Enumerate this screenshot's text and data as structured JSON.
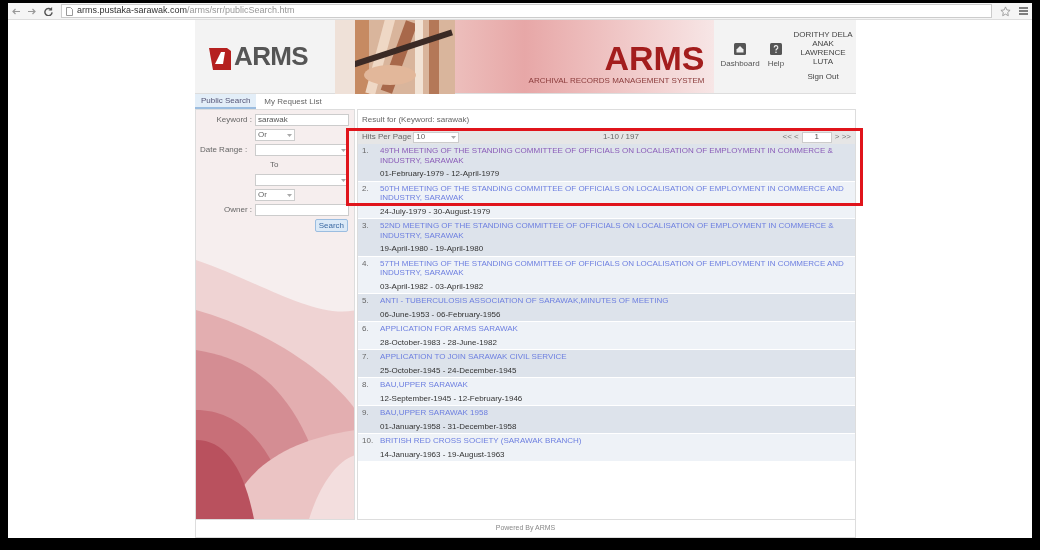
{
  "browser": {
    "url": "**arms.pustaka-sarawak.com**/arms/srr/publicSearch.htm"
  },
  "header": {
    "logo": "ARMS",
    "title": "ARMS",
    "subtitle": "ARCHIVAL RECORDS MANAGEMENT SYSTEM",
    "nav": [
      {
        "kind": "home",
        "label": "Dashboard"
      },
      {
        "kind": "help",
        "label": "Help"
      }
    ],
    "user": "DORITHY DELA ANAK LAWRENCE LUTA",
    "sign_out": "Sign Out"
  },
  "tabs": [
    {
      "label": "Public Search",
      "selected": true
    },
    {
      "label": "My Request List",
      "selected": false
    }
  ],
  "search": {
    "keyword_label": "Keyword :",
    "keyword": "sarawak",
    "operator_1": "Or",
    "date_label": "Date Range :",
    "to_label": "To",
    "operator_2": "Or",
    "owner_label": "Owner :",
    "button": "Search"
  },
  "results": {
    "heading": "Result for (Keyword: sarawak)",
    "hits_label": "Hits Per Page",
    "hits": "10",
    "range": "1-10 / 197",
    "first": "<< <",
    "page": "1",
    "next": "> >>",
    "rows": [
      {
        "number": "1.",
        "title": "49TH MEETING OF THE STANDING COMMITTEE OF OFFICIALS ON LOCALISATION OF EMPLOYMENT IN COMMERCE & INDUSTRY, SARAWAK",
        "dates": "01-February-1979 - 12-April-1979",
        "visited": true
      },
      {
        "number": "2.",
        "title": "50TH MEETING OF THE STANDING COMMITTEE OF OFFICIALS ON LOCALISATION OF EMPLOYMENT IN COMMERCE AND INDUSTRY, SARAWAK",
        "dates": "24-July-1979 - 30-August-1979",
        "visited": false
      },
      {
        "number": "3.",
        "title": "52ND MEETING OF THE STANDING COMMITTEE OF OFFICIALS ON LOCALISATION OF EMPLOYMENT IN COMMERCE & INDUSTRY, SARAWAK",
        "dates": "19-April-1980 - 19-April-1980",
        "visited": false
      },
      {
        "number": "4.",
        "title": "57TH MEETING OF THE STANDING COMMITTEE OF OFFICIALS ON LOCALISATION OF EMPLOYMENT IN COMMERCE AND INDUSTRY, SARAWAK",
        "dates": "03-April-1982 - 03-April-1982",
        "visited": false
      },
      {
        "number": "5.",
        "title": "ANTI - TUBERCULOSIS ASSOCIATION OF SARAWAK,MINUTES OF MEETING",
        "dates": "06-June-1953 - 06-February-1956",
        "visited": false
      },
      {
        "number": "6.",
        "title": "APPLICATION FOR ARMS SARAWAK",
        "dates": "28-October-1983 - 28-June-1982",
        "visited": false
      },
      {
        "number": "7.",
        "title": "APPLICATION TO JOIN SARAWAK CIVIL SERVICE",
        "dates": "25-October-1945 - 24-December-1945",
        "visited": false
      },
      {
        "number": "8.",
        "title": "BAU,UPPER SARAWAK",
        "dates": "12-September-1945 - 12-February-1946",
        "visited": false
      },
      {
        "number": "9.",
        "title": "BAU,UPPER SARAWAK 1958",
        "dates": "01-January-1958 - 31-December-1958",
        "visited": false
      },
      {
        "number": "10.",
        "title": "BRITISH RED CROSS SOCIETY (SARAWAK BRANCH)",
        "dates": "14-January-1963 - 19-August-1963",
        "visited": false
      }
    ]
  },
  "footer": "Powered By ARMS",
  "annotation": {
    "kind": "highlight"
  }
}
